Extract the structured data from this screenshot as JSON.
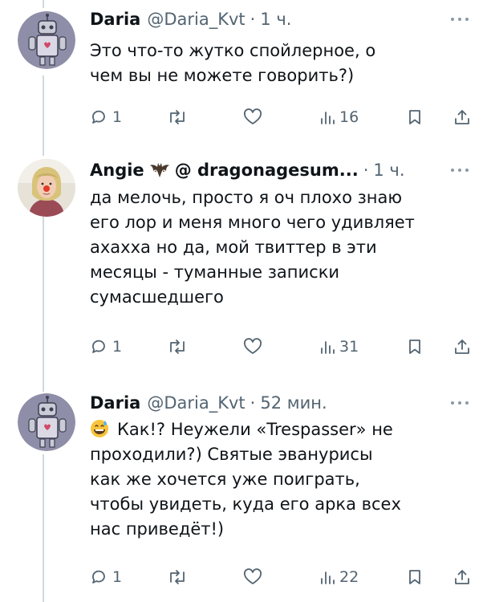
{
  "colors": {
    "text": "#0f1419",
    "secondary": "#536471",
    "thread_line": "#cfd9de",
    "avatar_bg": "#8f8ea8",
    "nose": "#e03a2b"
  },
  "tweets": [
    {
      "name": "Daria",
      "handle": "@Daria_Kvt",
      "dot": "·",
      "time": "1 ч.",
      "lines": [
        "Это что-то жутко спойлерное, о",
        "чем вы не можете говорить?)"
      ],
      "replies": "1",
      "views": "16",
      "avatar_icon": "robot-avatar",
      "badge_icon": ""
    },
    {
      "name": "Angie",
      "handle": "@ dragonagesum...",
      "dot": "·",
      "time": "1 ч.",
      "lines": [
        "да мелочь, просто я оч плохо знаю",
        "его лор и меня много чего удивляет",
        "ахахха но да, мой твиттер в эти",
        "месяцы - туманные записки",
        "сумасшедшего"
      ],
      "replies": "1",
      "views": "31",
      "avatar_icon": "clown-nose-avatar",
      "badge_icon": "bat-icon"
    },
    {
      "name": "Daria",
      "handle": "@Daria_Kvt",
      "dot": "·",
      "time": "52 мин.",
      "lines": [
        "Как!? Неужели «Trespasser» не",
        "проходили?) Святые эванурисы",
        "как же хочется уже поиграть,",
        "чтобы увидеть, куда его арка всех",
        "нас приведёт!)"
      ],
      "emoji": "grinning-sweat-emoji",
      "replies": "1",
      "views": "22",
      "avatar_icon": "robot-avatar",
      "badge_icon": ""
    }
  ]
}
